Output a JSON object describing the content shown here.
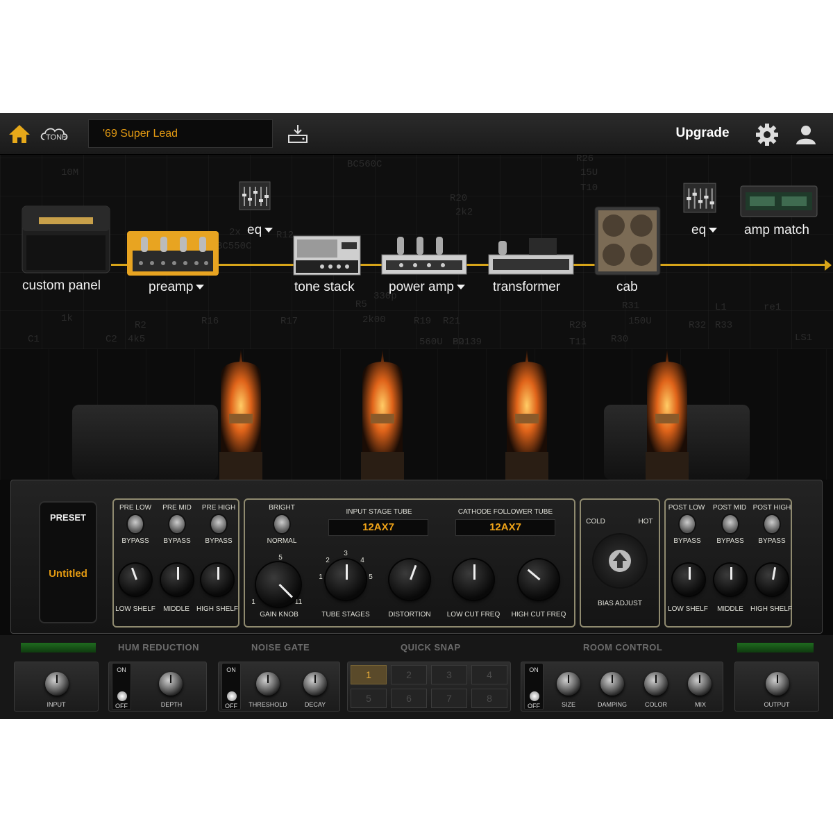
{
  "topbar": {
    "tone_label": "TONE",
    "preset_name": "'69 Super Lead",
    "upgrade_label": "Upgrade"
  },
  "chain": {
    "modules": [
      {
        "label": "custom panel",
        "dropdown": false
      },
      {
        "label": "preamp",
        "dropdown": true
      },
      {
        "label": "eq",
        "dropdown": true
      },
      {
        "label": "tone stack",
        "dropdown": false
      },
      {
        "label": "power amp",
        "dropdown": true
      },
      {
        "label": "transformer",
        "dropdown": false
      },
      {
        "label": "cab",
        "dropdown": false
      },
      {
        "label": "eq",
        "dropdown": true
      },
      {
        "label": "amp match",
        "dropdown": false
      }
    ],
    "selected": "preamp",
    "accent_color": "#d7a419",
    "schematic_labels": [
      "10M",
      "BC560C",
      "R26",
      "15U",
      "T10",
      "R20",
      "2k2",
      "2x",
      "BC550C",
      "R12",
      "1k",
      "R5",
      "2k00",
      "330p",
      "R31",
      "150U",
      "R32",
      "R33",
      "BD139",
      "R21",
      "R28",
      "560U",
      "R19",
      "R17",
      "R16",
      "R2",
      "4k5",
      "C2",
      "C1",
      "L1",
      "re1",
      "LS1",
      "R30",
      "P2",
      "T11"
    ]
  },
  "preset_panel": {
    "header": "PRESET",
    "name": "Untitled"
  },
  "eq_pre": {
    "switches": [
      {
        "top": "PRE LOW",
        "bottom": "BYPASS"
      },
      {
        "top": "PRE MID",
        "bottom": "BYPASS"
      },
      {
        "top": "PRE HIGH",
        "bottom": "BYPASS"
      }
    ],
    "knobs": [
      "LOW SHELF",
      "MIDDLE",
      "HIGH SHELF"
    ]
  },
  "preamp_controls": {
    "bright_top": "BRIGHT",
    "bright_bottom": "NORMAL",
    "input_stage_label": "INPUT STAGE TUBE",
    "input_stage_value": "12AX7",
    "cathode_label": "CATHODE FOLLOWER TUBE",
    "cathode_value": "12AX7",
    "knobs": [
      "GAIN KNOB",
      "TUBE STAGES",
      "DISTORTION",
      "LOW CUT FREQ",
      "HIGH CUT FREQ"
    ],
    "tube_stage_ticks": [
      "1",
      "2",
      "3",
      "4",
      "5"
    ],
    "gain_ticks": [
      "1",
      "5",
      "11"
    ]
  },
  "bias": {
    "cold": "COLD",
    "hot": "HOT",
    "label": "BIAS ADJUST"
  },
  "eq_post": {
    "switches": [
      {
        "top": "POST LOW",
        "bottom": "BYPASS"
      },
      {
        "top": "POST MID",
        "bottom": "BYPASS"
      },
      {
        "top": "POST HIGH",
        "bottom": "BYPASS"
      }
    ],
    "knobs": [
      "LOW SHELF",
      "MIDDLE",
      "HIGH SHELF"
    ]
  },
  "bottom": {
    "headers": [
      "HUM REDUCTION",
      "NOISE GATE",
      "QUICK SNAP",
      "ROOM CONTROL"
    ],
    "input_label": "INPUT",
    "depth_label": "DEPTH",
    "threshold_label": "THRESHOLD",
    "decay_label": "DECAY",
    "toggle_on": "ON",
    "toggle_off": "OFF",
    "snaps": [
      "1",
      "2",
      "3",
      "4",
      "5",
      "6",
      "7",
      "8"
    ],
    "active_snap": "1",
    "room_knobs": [
      "SIZE",
      "DAMPING",
      "COLOR",
      "MIX"
    ],
    "output_label": "OUTPUT"
  }
}
